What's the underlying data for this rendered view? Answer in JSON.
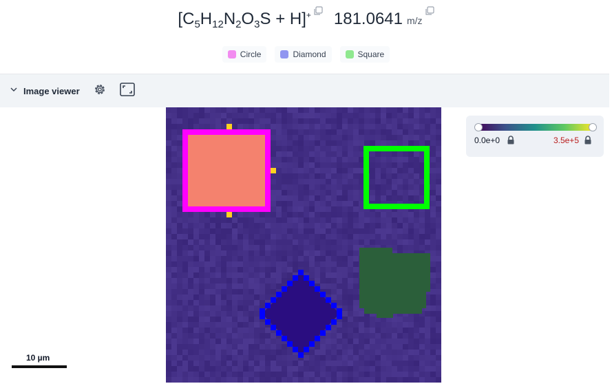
{
  "header": {
    "formula": {
      "open": "[",
      "c": "C",
      "c_sub": "5",
      "h": "H",
      "h_sub": "12",
      "n": "N",
      "n_sub": "2",
      "o": "O",
      "o_sub": "3",
      "rest": "S + H]",
      "charge": "+"
    },
    "mz_value": "181.0641",
    "mz_unit": "m/z",
    "copy_icon": "copy-icon"
  },
  "legend": {
    "items": [
      {
        "label": "Circle",
        "color": "#f28cf0"
      },
      {
        "label": "Diamond",
        "color": "#9196f0"
      },
      {
        "label": "Square",
        "color": "#8fe88f"
      }
    ]
  },
  "toolbar": {
    "title": "Image viewer",
    "chevron_icon": "chevron-down-icon",
    "settings_icon": "gear-icon",
    "fullscreen_icon": "fullscreen-icon"
  },
  "colorbar": {
    "min_label": "0.0e+0",
    "max_label": "3.5e+5",
    "max_color": "#b91c1c",
    "colormap": [
      "#440154",
      "#3b528b",
      "#21918c",
      "#5ec962",
      "#fde725"
    ],
    "lock_icon": "lock-icon"
  },
  "scalebar": {
    "label": "10 µm"
  },
  "regions": {
    "circle": {
      "name": "Circle",
      "outline": "#ff00ff",
      "fill": "#f4826e"
    },
    "diamond": {
      "name": "Diamond",
      "outline": "#0000ff",
      "fill": "#2a0d80"
    },
    "square": {
      "name": "Square",
      "outline": "#00ff00",
      "fill": "#2b5f3a"
    }
  }
}
